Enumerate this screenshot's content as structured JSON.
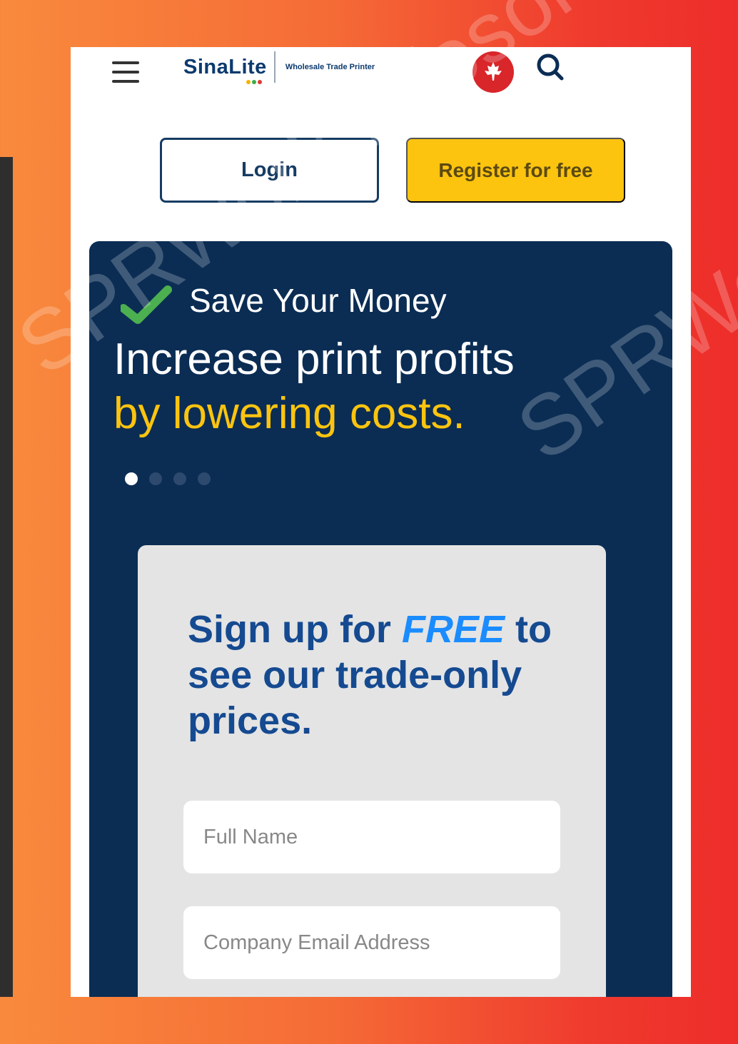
{
  "header": {
    "logo_text": "SinaLite",
    "logo_tagline": "Wholesale Trade Printer",
    "logo_dot_colors": [
      "#f5b400",
      "#3cab4c",
      "#e23a2e"
    ]
  },
  "auth": {
    "login_label": "Login",
    "register_label": "Register for free"
  },
  "hero": {
    "tag": "Save Your Money",
    "headline": "Increase print profits",
    "highlight": "by lowering costs.",
    "carousel_count": 4,
    "carousel_active": 1
  },
  "signup": {
    "heading_pre": "Sign up for ",
    "heading_free": "FREE",
    "heading_post": " to see our trade-only prices.",
    "full_name_placeholder": "Full Name",
    "email_placeholder": "Company Email Address"
  },
  "watermark": {
    "text1": "SPRWork Infosol",
    "text2": "SPRWork"
  },
  "colors": {
    "hero_bg": "#0b2d54",
    "accent_yellow": "#fcc40f",
    "brand_blue": "#154a91",
    "free_blue": "#1a8cff",
    "check_green": "#4caf50"
  }
}
